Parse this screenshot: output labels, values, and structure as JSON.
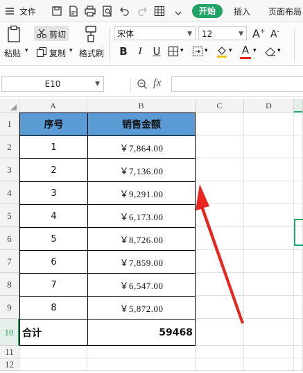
{
  "menubar": {
    "file": "文件",
    "start": "开始",
    "insert": "插入",
    "page_layout": "页面布局"
  },
  "ribbon": {
    "paste": "粘贴",
    "cut": "剪切",
    "copy": "复制",
    "format_painter": "格式刷",
    "font_name": "宋体",
    "font_size": "12"
  },
  "formula_bar": {
    "name_box": "E10",
    "fx": "fx",
    "formula": ""
  },
  "sheet": {
    "columns": [
      "A",
      "B",
      "C",
      "D"
    ],
    "rows": [
      "1",
      "2",
      "3",
      "4",
      "5",
      "6",
      "7",
      "8",
      "9",
      "10",
      "11",
      "12"
    ],
    "table": {
      "headers": [
        "序号",
        "销售金额"
      ],
      "rows": [
        {
          "no": "1",
          "amount": "￥7,864.00"
        },
        {
          "no": "2",
          "amount": "￥7,136.00"
        },
        {
          "no": "3",
          "amount": "￥9,291.00"
        },
        {
          "no": "4",
          "amount": "￥6,173.00"
        },
        {
          "no": "5",
          "amount": "￥8,726.00"
        },
        {
          "no": "6",
          "amount": "￥7,859.00"
        },
        {
          "no": "7",
          "amount": "￥6,547.00"
        },
        {
          "no": "8",
          "amount": "￥5,872.00"
        }
      ],
      "total_label": "合计",
      "total_value": "59468"
    }
  },
  "colors": {
    "header_fill": "#5b9bd5",
    "accent_green": "#21a366",
    "arrow_red": "#e8261f"
  }
}
